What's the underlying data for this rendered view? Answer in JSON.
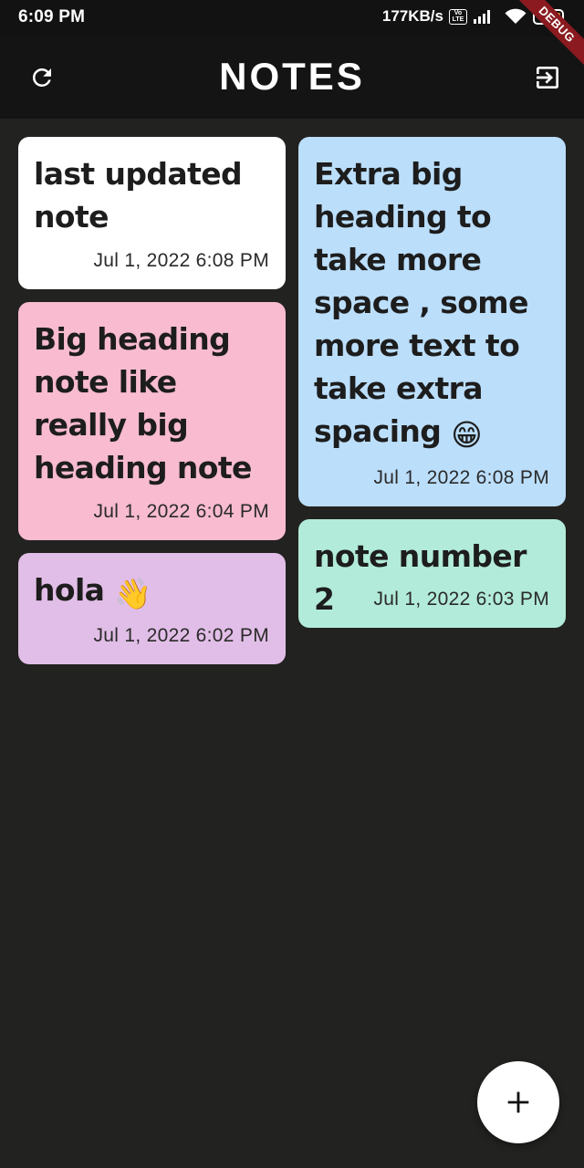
{
  "status_bar": {
    "time": "6:09 PM",
    "net_speed": "177KB/s",
    "volte_top": "Vo",
    "volte_bottom": "LTE",
    "battery": "27",
    "debug_label": "DEBUG"
  },
  "app_bar": {
    "title": "NOTES",
    "refresh_icon": "refresh-icon",
    "logout_icon": "logout-icon"
  },
  "notes": [
    {
      "title": "last updated note",
      "date": "Jul 1, 2022 6:08 PM",
      "color": "#ffffff"
    },
    {
      "title": "Big heading note like really big heading note",
      "date": "Jul 1, 2022 6:04 PM",
      "color": "#f8bbd0"
    },
    {
      "title": "hola",
      "emoji": "👋",
      "date": "Jul 1, 2022 6:02 PM",
      "color": "#e1bee7"
    },
    {
      "title": "Extra big heading to take more space , some more text to take extra spacing",
      "emoji": "😁",
      "date": "Jul 1, 2022 6:08 PM",
      "color": "#bbdefb"
    },
    {
      "title": "note number 2",
      "date": "Jul 1, 2022 6:03 PM",
      "color": "#b2ebd9"
    }
  ],
  "fab": {
    "icon": "plus-icon"
  }
}
